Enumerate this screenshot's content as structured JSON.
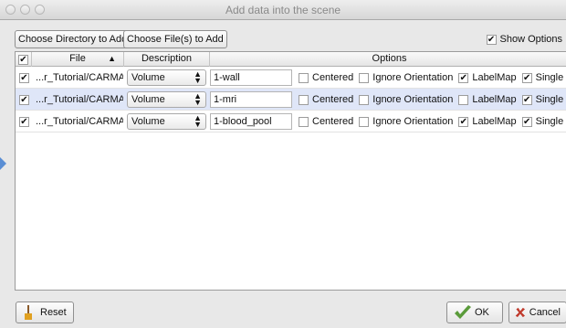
{
  "window": {
    "title": "Add data into the scene"
  },
  "toolbar": {
    "choose_directory_label": "Choose Directory to Add",
    "choose_files_label": "Choose File(s) to Add",
    "show_options_label": "Show Options",
    "show_options_checked": true
  },
  "table": {
    "headers": {
      "file": "File",
      "description": "Description",
      "options": "Options"
    },
    "rows": [
      {
        "checked": true,
        "file": "...r_Tutorial/CARMA-",
        "description": "Volume",
        "name": "1-wall",
        "centered_label": "Centered",
        "centered": false,
        "ignore_label": "Ignore Orientation",
        "ignore": false,
        "labelmap_label": "LabelMap",
        "labelmap": true,
        "single_label": "Single File",
        "single": true,
        "selected": false
      },
      {
        "checked": true,
        "file": "...r_Tutorial/CARMA-",
        "description": "Volume",
        "name": "1-mri",
        "centered_label": "Centered",
        "centered": false,
        "ignore_label": "Ignore Orientation",
        "ignore": false,
        "labelmap_label": "LabelMap",
        "labelmap": false,
        "single_label": "Single File",
        "single": true,
        "selected": true
      },
      {
        "checked": true,
        "file": "...r_Tutorial/CARMA-",
        "description": "Volume",
        "name": "1-blood_pool",
        "centered_label": "Centered",
        "centered": false,
        "ignore_label": "Ignore Orientation",
        "ignore": false,
        "labelmap_label": "LabelMap",
        "labelmap": true,
        "single_label": "Single File",
        "single": true,
        "selected": false
      }
    ]
  },
  "footer": {
    "reset_label": "Reset",
    "ok_label": "OK",
    "cancel_label": "Cancel"
  },
  "colors": {
    "selection": "#dfe6f8",
    "ok_icon": "#5a9b3a",
    "cancel_icon": "#c0392b",
    "broom_icon": "#e0a020"
  }
}
